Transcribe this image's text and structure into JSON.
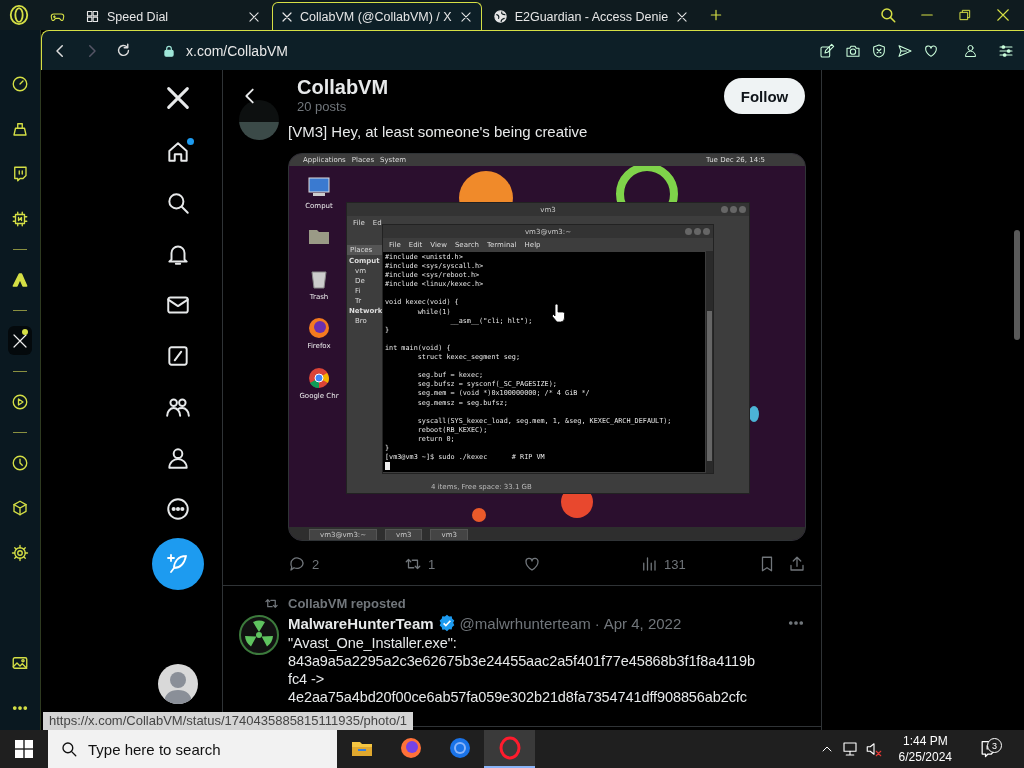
{
  "browser": {
    "tabs": [
      {
        "kind": "game",
        "selected": false
      },
      {
        "kind": "grid",
        "title": "Speed Dial",
        "selected": false
      },
      {
        "kind": "x",
        "title": "CollabVM (@CollabVM) / X",
        "selected": true
      },
      {
        "kind": "globe",
        "title": "E2Guardian - Access Denie",
        "selected": false
      }
    ],
    "address": {
      "url": "x.com/CollabVM",
      "can_go_forward": false
    },
    "sidebar": {
      "groups": [
        [
          {
            "kind": "speed",
            "selected": false,
            "badge": false
          },
          {
            "kind": "basket",
            "selected": false,
            "badge": false
          },
          {
            "kind": "chat",
            "selected": false,
            "badge": false
          },
          {
            "kind": "chip",
            "selected": false,
            "badge": false
          }
        ],
        [
          {
            "kind": "triangle",
            "selected": false,
            "badge": false
          }
        ],
        [
          {
            "kind": "x",
            "selected": true,
            "badge": true
          }
        ],
        [
          {
            "kind": "play",
            "selected": false,
            "badge": false
          }
        ],
        [
          {
            "kind": "clock",
            "selected": false,
            "badge": false
          },
          {
            "kind": "cube",
            "selected": false,
            "badge": false
          },
          {
            "kind": "settings",
            "selected": false,
            "badge": false
          }
        ]
      ],
      "bottom": [
        {
          "kind": "image",
          "selected": false,
          "badge": false
        },
        {
          "kind": "more",
          "selected": false,
          "badge": false
        }
      ]
    }
  },
  "x": {
    "nav": [
      {
        "kind": "logo",
        "unread": false
      },
      {
        "kind": "home",
        "unread": true
      },
      {
        "kind": "search",
        "unread": false
      },
      {
        "kind": "bell",
        "unread": false
      },
      {
        "kind": "mail",
        "unread": false
      },
      {
        "kind": "grok",
        "unread": false
      },
      {
        "kind": "people",
        "unread": false
      },
      {
        "kind": "profile",
        "unread": false
      },
      {
        "kind": "more",
        "unread": false
      }
    ],
    "header": {
      "name": "CollabVM",
      "posts": "20 posts",
      "follow": "Follow"
    },
    "posts": [
      {
        "kind": "post",
        "text": "[VM3] Hey, at least someone's being creative",
        "replies": "2",
        "reposts": "1",
        "views": "131",
        "liked": false,
        "bookmarked": false,
        "media": {
          "top_menu": [
            "Applications",
            "Places",
            "System"
          ],
          "clock": "Tue Dec 26, 14:5",
          "desktop_icons": [
            {
              "kind": "computer",
              "label": "Comput"
            },
            {
              "kind": "folder"
            },
            {
              "kind": "trash",
              "label": "Trash"
            },
            {
              "kind": "firefox",
              "label": "Firefox"
            },
            {
              "kind": "chrome",
              "label": "Google Chr"
            }
          ],
          "file_manager": {
            "title": "vm3",
            "menu": [
              "File",
              "Ed"
            ],
            "heading": "Places",
            "sections": [
              {
                "title": "Comput",
                "items": [
                  "vm",
                  "De",
                  "Fi",
                  "Tr"
                ]
              },
              {
                "title": "Network",
                "items": [
                  "Bro"
                ]
              }
            ],
            "status": "4 items, Free space: 33.1 GB"
          },
          "terminal": {
            "title": "vm3@vm3:~",
            "menu": [
              "File",
              "Edit",
              "View",
              "Search",
              "Terminal",
              "Help"
            ],
            "text": "#include <unistd.h>\n#include <sys/syscall.h>\n#include <sys/reboot.h>\n#include <linux/kexec.h>\n\nvoid kexec(void) {\n        while(1)\n                __asm__(\"cli; hlt\");\n}\n\nint main(void) {\n        struct kexec_segment seg;\n\n        seg.buf = kexec;\n        seg.bufsz = sysconf(_SC_PAGESIZE);\n        seg.mem = (void *)0x100000000; /* 4 GiB */\n        seg.memsz = seg.bufsz;\n\n        syscall(SYS_kexec_load, seg.mem, 1, &seg, KEXEC_ARCH_DEFAULT);\n        reboot(RB_KEXEC);\n        return 0;\n}\n[vm3@vm3 ~]$ sudo ./kexec      # RIP VM"
          },
          "panel_buttons": [
            "vm3@vm3:~",
            "vm3",
            "vm3"
          ]
        }
      },
      {
        "kind": "repost",
        "reposted_by": "CollabVM reposted",
        "author": "MalwareHunterTeam",
        "verified": true,
        "handle": "@malwrhunterteam",
        "separator": "·",
        "date": "Apr 4, 2022",
        "text": "\"Avast_One_Installer.exe\":\n843a9a5a2295a2c3e62675b3e24455aac2a5f401f77e45868b3f1f8a4119b\nfc4 ->\n4e2aa75a4bd20f00ce6ab57fa059e302b21d8fa7354741dff908856ab2cfc"
      }
    ]
  },
  "status_url": "https://x.com/CollabVM/status/1740435885815111935/photo/1",
  "taskbar": {
    "search_placeholder": "Type here to search",
    "apps": [
      {
        "kind": "folder",
        "selected": false
      },
      {
        "kind": "firefox",
        "selected": false
      },
      {
        "kind": "chrome",
        "selected": false
      },
      {
        "kind": "opera",
        "selected": true
      }
    ],
    "muted": true,
    "time": "1:44 PM",
    "date": "6/25/2024",
    "notifications": "3"
  }
}
